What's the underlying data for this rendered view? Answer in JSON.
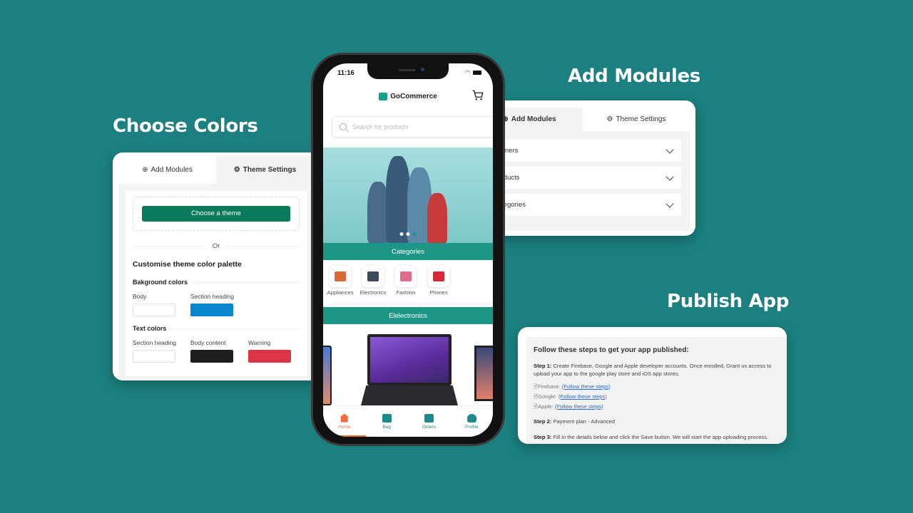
{
  "headings": {
    "choose_colors": "Choose Colors",
    "add_modules": "Add Modules",
    "publish_app": "Publish App"
  },
  "colors_panel": {
    "tabs": [
      {
        "label": "Add Modules",
        "icon": "plus-circle-icon",
        "active": false
      },
      {
        "label": "Theme Settings",
        "icon": "gear-icon",
        "active": true
      }
    ],
    "choose_theme_button": "Choose a theme",
    "or_label": "Or",
    "section_title": "Customise theme color palette",
    "background_colors": {
      "title": "Bakground colors",
      "swatches": [
        {
          "label": "Body",
          "color": "#ffffff"
        },
        {
          "label": "Section heading",
          "color": "#0a85d0"
        }
      ]
    },
    "text_colors": {
      "title": "Text colors",
      "swatches": [
        {
          "label": "Section heading",
          "color": "#ffffff"
        },
        {
          "label": "Body content",
          "color": "#1e1e1e"
        },
        {
          "label": "Warning",
          "color": "#dc3545"
        }
      ]
    }
  },
  "modules_panel": {
    "tabs": [
      {
        "label": "Add Modules",
        "icon": "plus-circle-icon",
        "active": true
      },
      {
        "label": "Theme Settings",
        "icon": "gear-icon",
        "active": false
      }
    ],
    "accordions": [
      "Banners",
      "Products",
      "Categories"
    ]
  },
  "publish_panel": {
    "title": "Follow these steps to get your app published:",
    "step1_label": "Step 1:",
    "step1_text": "Create Firebase, Google and Apple developer accounts. Once enrolled, Grant us access to upload your app to the google play store and iOS app stores.",
    "links": [
      {
        "label": "Firebase:",
        "link": "(Follow these steps)"
      },
      {
        "label": "Google:",
        "link": "(Follow these steps)"
      },
      {
        "label": "Apple:",
        "link": "(Follow these steps)"
      }
    ],
    "step2_label": "Step 2:",
    "step2_text": "Payment plan - Advanced",
    "step3_label": "Step 3:",
    "step3_text": "Fill in the details below and click the Save button. We will start the app uploading process."
  },
  "phone": {
    "time": "11:16",
    "app_name": "GoCommerce",
    "search_placeholder": "Search for products",
    "categories_heading": "Categories",
    "categories": [
      {
        "label": "Appliances",
        "color": "#d86a3a"
      },
      {
        "label": "Electronics",
        "color": "#3a4a5a"
      },
      {
        "label": "Fashion",
        "color": "#e06a8a"
      },
      {
        "label": "Phones",
        "color": "#d8283a"
      }
    ],
    "products_heading": "Elelectronics",
    "banner_dots": 3,
    "active_dot": 2,
    "nav": [
      {
        "label": "Home",
        "icon": "home-icon",
        "active": true
      },
      {
        "label": "Bag",
        "icon": "bag-icon",
        "active": false
      },
      {
        "label": "Orders",
        "icon": "truck-icon",
        "active": false
      },
      {
        "label": "Profile",
        "icon": "user-icon",
        "active": false
      }
    ],
    "accent_color": "#1c9787",
    "active_nav_color": "#f26b3a"
  }
}
